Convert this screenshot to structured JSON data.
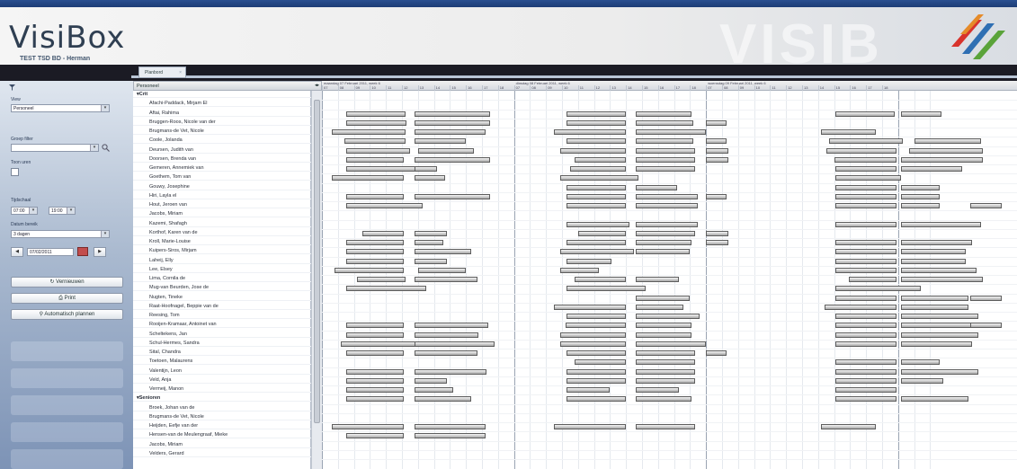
{
  "app": {
    "name": "VisiBox",
    "subtitle": "TEST TSD BD - Herman",
    "watermark": "VISIB"
  },
  "tab": {
    "label": "Planbord",
    "close": "×"
  },
  "sidebar": {
    "view_label": "View",
    "view_value": "Personeel",
    "group_filter_label": "Groep filter",
    "group_filter_value": "",
    "toon_uren_label": "Toon uren",
    "tijdschaal_label": "Tijdschaal",
    "time_from": "07:00",
    "time_to": "19:00",
    "datum_bereik_label": "Datum bereik",
    "range_value": "3 dagen",
    "date_value": "07/02/2011",
    "prev": "◀",
    "next": "▶",
    "refresh_label": "Vernieuwen",
    "print_label": "Print",
    "auto_plan_label": "Automatisch plannen"
  },
  "grid": {
    "name_header": "Personeel",
    "days": [
      "maandag 07 Februari 2011, week 6",
      "dinsdag 08 Februari 2011, week 6",
      "woensdag 09 Februari 2011, week 6"
    ],
    "hours": [
      "07",
      "08",
      "09",
      "10",
      "11",
      "12",
      "13",
      "14",
      "15",
      "16",
      "17",
      "18"
    ],
    "rows": [
      {
        "name": "▾Crit",
        "group": true
      },
      {
        "name": "Afachi-Paddack, Mirjam El"
      },
      {
        "name": "Aftai, Rahima"
      },
      {
        "name": "Bruggen-Roos, Nicole van der"
      },
      {
        "name": "Brugmans-de Vet, Nicole"
      },
      {
        "name": "Coole, Jolanda"
      },
      {
        "name": "Deursen, Judith van"
      },
      {
        "name": "Doorsen, Brenda van"
      },
      {
        "name": "Gemeren, Annemiek van"
      },
      {
        "name": "Goethem, Tom van"
      },
      {
        "name": "Gouwy, Josephine"
      },
      {
        "name": "Hiri, Layla el"
      },
      {
        "name": "Hout, Jeroen van"
      },
      {
        "name": "Jacobs, Miriam"
      },
      {
        "name": "Kazemi, Shafagh"
      },
      {
        "name": "Korthof, Karen van de"
      },
      {
        "name": "Kroll, Marie-Louise"
      },
      {
        "name": "Kuipers-Siros, Mirjam"
      },
      {
        "name": "Laheij, Elly"
      },
      {
        "name": "Lee, Elsey"
      },
      {
        "name": "Lima, Cornila de"
      },
      {
        "name": "Mug-van Beurden, Jose de"
      },
      {
        "name": "Nugten, Tineke"
      },
      {
        "name": "Raat-Hoofnagel, Beppie van de"
      },
      {
        "name": "Reesing, Tom"
      },
      {
        "name": "Rooijen-Kramaar, Antoinet van"
      },
      {
        "name": "Scheltekens, Jan"
      },
      {
        "name": "Schul-Hermes, Sandra"
      },
      {
        "name": "Sital, Chandra"
      },
      {
        "name": "Toetoen, Malaurens"
      },
      {
        "name": "Valentijn, Leon"
      },
      {
        "name": "Veld, Anja"
      },
      {
        "name": "Vermeij, Manon"
      },
      {
        "name": "▾Senioren",
        "group": true
      },
      {
        "name": "Broek, Johan van de"
      },
      {
        "name": "Brugmans-de Vet, Nicole"
      },
      {
        "name": "Heijden, Eefje van der"
      },
      {
        "name": "Hensen-van de Meulengraaf, Mieke"
      },
      {
        "name": "Jacobs, Miriam"
      },
      {
        "name": "Velders, Gerard"
      }
    ],
    "shifts": [
      [],
      [],
      [
        [
          1.5,
          5.2
        ],
        [
          5.8,
          10.5
        ],
        [
          15.3,
          19.0
        ],
        [
          19.6,
          23.1
        ],
        [
          32.1,
          35.8
        ],
        [
          36.2,
          38.7
        ]
      ],
      [
        [
          1.5,
          5.3
        ],
        [
          5.8,
          10.5
        ],
        [
          15.3,
          19.0
        ],
        [
          19.6,
          23.2
        ],
        [
          24.0,
          25.3
        ]
      ],
      [
        [
          0.6,
          5.2
        ],
        [
          5.8,
          10.2
        ],
        [
          14.5,
          19.0
        ],
        [
          19.6,
          24.0
        ],
        [
          31.2,
          34.6
        ]
      ],
      [
        [
          1.4,
          5.2
        ],
        [
          5.8,
          9.0
        ],
        [
          15.3,
          19.0
        ],
        [
          19.6,
          23.2
        ],
        [
          24.0,
          25.3
        ],
        [
          31.7,
          36.3
        ],
        [
          37.0,
          41.2
        ]
      ],
      [
        [
          1.5,
          5.5
        ],
        [
          6.0,
          9.5
        ],
        [
          14.9,
          19.0
        ],
        [
          19.6,
          23.3
        ],
        [
          24.0,
          25.4
        ],
        [
          31.5,
          35.9
        ],
        [
          36.7,
          41.3
        ]
      ],
      [
        [
          1.5,
          5.1
        ],
        [
          5.8,
          10.5
        ],
        [
          15.8,
          19.0
        ],
        [
          19.6,
          23.3
        ],
        [
          24.0,
          25.4
        ],
        [
          32.0,
          35.9
        ],
        [
          36.2,
          41.3
        ]
      ],
      [
        [
          1.5,
          6.2
        ],
        [
          5.8,
          7.2
        ],
        [
          15.5,
          19.0
        ],
        [
          19.6,
          23.3
        ],
        [
          32.1,
          35.9
        ],
        [
          36.2,
          40.0
        ]
      ],
      [
        [
          0.6,
          5.1
        ],
        [
          5.8,
          7.7
        ],
        [
          14.9,
          19.8
        ],
        [
          32.1,
          36.2
        ]
      ],
      [
        [
          15.3,
          19.0
        ],
        [
          19.6,
          22.2
        ],
        [
          32.1,
          35.9
        ],
        [
          36.2,
          38.6
        ]
      ],
      [
        [
          1.5,
          5.1
        ],
        [
          5.8,
          10.5
        ],
        [
          15.3,
          19.0
        ],
        [
          19.6,
          23.5
        ],
        [
          24.0,
          25.3
        ],
        [
          32.1,
          35.9
        ],
        [
          36.2,
          38.6
        ]
      ],
      [
        [
          1.5,
          6.3
        ],
        [
          15.3,
          19.0
        ],
        [
          19.6,
          23.5
        ],
        [
          32.1,
          35.9
        ],
        [
          36.2,
          38.6
        ],
        [
          40.5,
          42.5
        ]
      ],
      [],
      [
        [
          15.3,
          19.2
        ],
        [
          19.6,
          23.5
        ],
        [
          32.1,
          35.9
        ],
        [
          36.2,
          41.2
        ]
      ],
      [
        [
          2.5,
          5.1
        ],
        [
          5.8,
          7.8
        ],
        [
          16.0,
          19.0
        ],
        [
          19.6,
          23.3
        ],
        [
          24.0,
          25.4
        ]
      ],
      [
        [
          1.5,
          5.1
        ],
        [
          5.8,
          7.6
        ],
        [
          15.3,
          19.0
        ],
        [
          19.6,
          23.1
        ],
        [
          24.0,
          25.4
        ],
        [
          32.1,
          35.9
        ],
        [
          36.2,
          40.6
        ]
      ],
      [
        [
          1.5,
          5.1
        ],
        [
          5.8,
          9.3
        ],
        [
          14.9,
          19.5
        ],
        [
          19.6,
          23.0
        ],
        [
          32.1,
          35.9
        ],
        [
          36.2,
          40.2
        ]
      ],
      [
        [
          1.5,
          5.1
        ],
        [
          5.8,
          7.8
        ],
        [
          15.3,
          18.1
        ],
        [
          32.1,
          35.9
        ],
        [
          36.2,
          40.2
        ]
      ],
      [
        [
          0.8,
          5.1
        ],
        [
          6.0,
          9.0
        ],
        [
          14.9,
          17.3
        ],
        [
          32.1,
          35.9
        ],
        [
          36.2,
          40.9
        ]
      ],
      [
        [
          2.2,
          5.2
        ],
        [
          5.8,
          9.7
        ],
        [
          15.8,
          19.0
        ],
        [
          19.6,
          22.3
        ],
        [
          32.9,
          35.9
        ],
        [
          36.2,
          41.3
        ]
      ],
      [
        [
          1.5,
          6.5
        ],
        [
          15.3,
          20.2
        ],
        [
          32.1,
          37.4
        ]
      ],
      [
        [
          19.6,
          23.0
        ],
        [
          32.1,
          35.9
        ],
        [
          36.2,
          40.4
        ],
        [
          40.5,
          42.5
        ]
      ],
      [
        [
          14.5,
          19.0
        ],
        [
          19.6,
          22.6
        ],
        [
          31.4,
          35.9
        ],
        [
          36.2,
          40.4
        ]
      ],
      [
        [
          15.3,
          19.0
        ],
        [
          19.6,
          23.6
        ],
        [
          32.1,
          35.9
        ],
        [
          36.2,
          41.0
        ]
      ],
      [
        [
          1.5,
          5.1
        ],
        [
          5.8,
          10.4
        ],
        [
          15.2,
          19.0
        ],
        [
          19.6,
          23.1
        ],
        [
          32.1,
          35.9
        ],
        [
          36.2,
          41.0
        ],
        [
          40.5,
          42.5
        ]
      ],
      [
        [
          1.5,
          5.1
        ],
        [
          5.8,
          9.8
        ],
        [
          14.9,
          19.0
        ],
        [
          19.6,
          23.1
        ],
        [
          32.1,
          35.9
        ],
        [
          36.2,
          41.0
        ]
      ],
      [
        [
          1.2,
          6.2
        ],
        [
          5.8,
          10.8
        ],
        [
          14.9,
          19.0
        ],
        [
          19.6,
          24.0
        ],
        [
          32.1,
          35.9
        ],
        [
          36.2,
          40.6
        ]
      ],
      [
        [
          1.5,
          5.1
        ],
        [
          5.8,
          9.7
        ],
        [
          15.3,
          19.0
        ],
        [
          19.6,
          23.3
        ],
        [
          24.0,
          25.3
        ]
      ],
      [
        [
          15.8,
          19.0
        ],
        [
          19.6,
          23.3
        ],
        [
          32.1,
          35.9
        ],
        [
          36.2,
          38.6
        ]
      ],
      [
        [
          1.5,
          5.1
        ],
        [
          5.8,
          10.3
        ],
        [
          15.3,
          19.0
        ],
        [
          19.6,
          23.3
        ],
        [
          32.1,
          35.9
        ],
        [
          36.2,
          41.0
        ]
      ],
      [
        [
          1.5,
          5.1
        ],
        [
          5.8,
          7.8
        ],
        [
          15.3,
          19.0
        ],
        [
          19.6,
          23.3
        ],
        [
          32.1,
          35.9
        ],
        [
          36.2,
          38.8
        ]
      ],
      [
        [
          1.5,
          5.1
        ],
        [
          5.8,
          8.2
        ],
        [
          15.3,
          18.0
        ],
        [
          19.6,
          22.3
        ],
        [
          32.1,
          35.9
        ]
      ],
      [
        [
          1.5,
          5.1
        ],
        [
          5.8,
          9.3
        ],
        [
          15.3,
          19.0
        ],
        [
          19.6,
          23.1
        ],
        [
          32.1,
          35.9
        ],
        [
          36.2,
          40.4
        ]
      ],
      [],
      [],
      [
        [
          0.6,
          5.1
        ],
        [
          5.8,
          10.2
        ],
        [
          14.5,
          19.0
        ],
        [
          19.6,
          23.3
        ],
        [
          31.2,
          34.6
        ]
      ],
      [
        [
          1.5,
          5.1
        ],
        [
          5.8,
          10.2
        ]
      ],
      [],
      [],
      []
    ]
  }
}
